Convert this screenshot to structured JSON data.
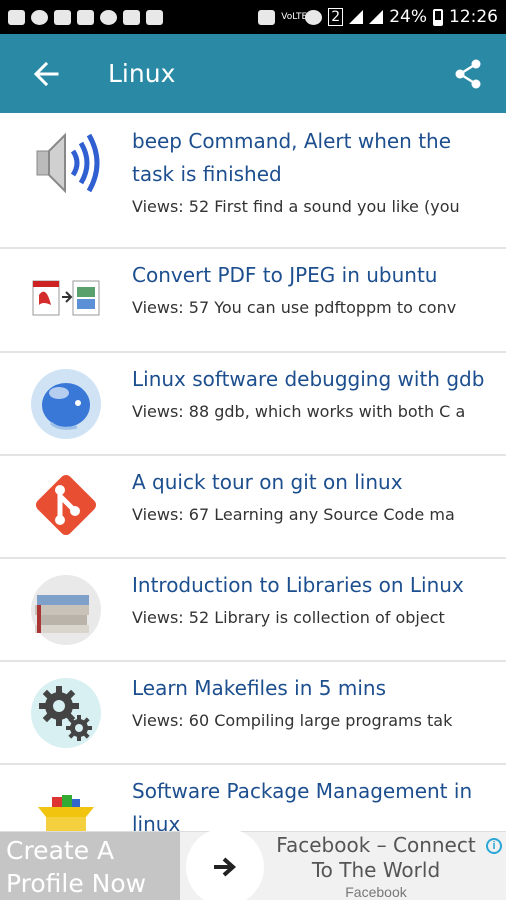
{
  "status_bar": {
    "battery": "24%",
    "time": "12:26",
    "network_badge": "2",
    "volte": "VoLTE"
  },
  "app_bar": {
    "title": "Linux",
    "back_icon": "arrow-left-icon",
    "share_icon": "share-icon"
  },
  "articles": [
    {
      "title": "beep Command, Alert when the task is finished",
      "snippet": "Views: 52 First find a sound you like (you",
      "icon": "speaker-icon"
    },
    {
      "title": "Convert PDF to JPEG in ubuntu",
      "snippet": "Views: 57 You can use pdftoppm to conv",
      "icon": "pdf-to-jpeg-icon"
    },
    {
      "title": "Linux software debugging with gdb",
      "snippet": "Views: 88 gdb, which works with both C a",
      "icon": "gdb-fish-icon"
    },
    {
      "title": "A quick tour on git on linux",
      "snippet": "Views: 67 Learning any Source Code ma",
      "icon": "git-icon"
    },
    {
      "title": "Introduction to Libraries on Linux",
      "snippet": "Views: 52   Library is collection of object",
      "icon": "books-icon"
    },
    {
      "title": "Learn Makefiles in 5 mins",
      "snippet": "Views: 60   Compiling large programs tak",
      "icon": "gears-icon"
    },
    {
      "title": "Software Package Management in linux",
      "snippet": "",
      "icon": "package-icon"
    }
  ],
  "ad": {
    "left_text": "Create A Profile Now",
    "headline": "Facebook – Connect To The World",
    "source": "Facebook",
    "arrow_icon": "arrow-right-icon",
    "info_icon": "adchoices-info-icon",
    "info_glyph": "i"
  },
  "colors": {
    "app_bar": "#2a8aa6",
    "title_text": "#1d4f8f"
  }
}
